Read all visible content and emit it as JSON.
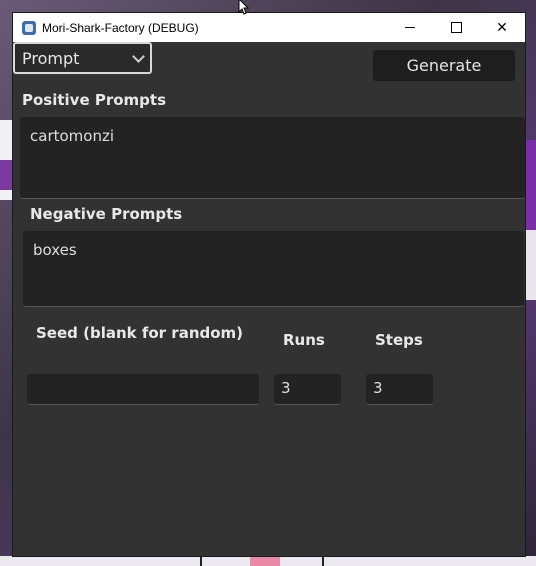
{
  "window": {
    "title": "Mori-Shark-Factory (DEBUG)",
    "controls": {
      "minimize_icon": "minimize-icon",
      "maximize_icon": "maximize-icon",
      "close_icon": "close-icon",
      "close_glyph": "✕"
    }
  },
  "toolbar": {
    "mode_dropdown": {
      "selected": "Prompt"
    },
    "generate_label": "Generate"
  },
  "form": {
    "positive": {
      "label": "Positive Prompts",
      "value": "cartomonzi"
    },
    "negative": {
      "label": "Negative Prompts",
      "value": "boxes"
    },
    "seed": {
      "label": "Seed (blank for random)",
      "value": ""
    },
    "runs": {
      "label": "Runs",
      "value": "3"
    },
    "steps": {
      "label": "Steps",
      "value": "3"
    }
  },
  "colors": {
    "window_bg": "#323232",
    "field_bg": "#232323",
    "button_bg": "#1e1e1e",
    "text": "#e8e8e8"
  }
}
